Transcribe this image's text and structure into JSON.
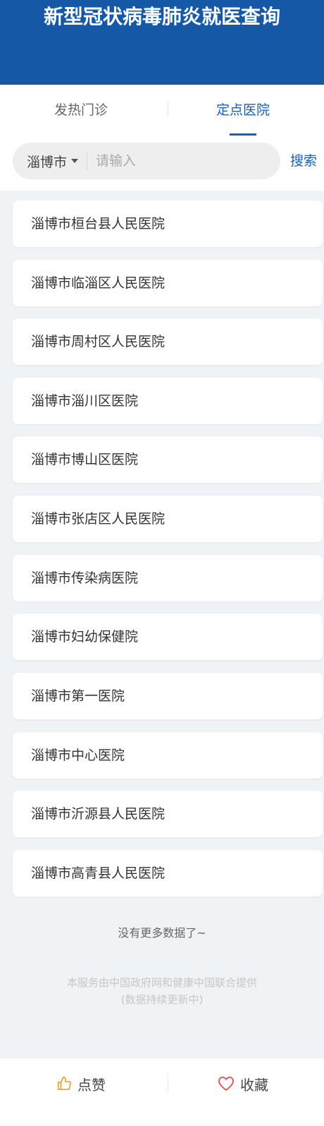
{
  "header": {
    "title": "新型冠状病毒肺炎就医查询",
    "bg_color": "#1458a6"
  },
  "tabs": [
    {
      "label": "发热门诊",
      "active": false
    },
    {
      "label": "定点医院",
      "active": true
    }
  ],
  "search": {
    "city": "淄博市",
    "placeholder": "请输入",
    "value": "",
    "button_label": "搜索"
  },
  "hospitals": [
    "淄博市桓台县人民医院",
    "淄博市临淄区人民医院",
    "淄博市周村区人民医院",
    "淄博市淄川区医院",
    "淄博市博山区医院",
    "淄博市张店区人民医院",
    "淄博市传染病医院",
    "淄博市妇幼保健院",
    "淄博市第一医院",
    "淄博市中心医院",
    "淄博市沂源县人民医院",
    "淄博市高青县人民医院"
  ],
  "no_more_text": "没有更多数据了~",
  "footer": {
    "line1": "本服务由中国政府网和健康中国联合提供",
    "line2": "(数据持续更新中)"
  },
  "bottom_bar": {
    "like_label": "点赞",
    "like_icon": "thumbs-up-icon",
    "like_color": "#e8a33c",
    "favorite_label": "收藏",
    "favorite_icon": "heart-icon",
    "favorite_color": "#e05c5c"
  },
  "accent_color": "#1a5fb4"
}
